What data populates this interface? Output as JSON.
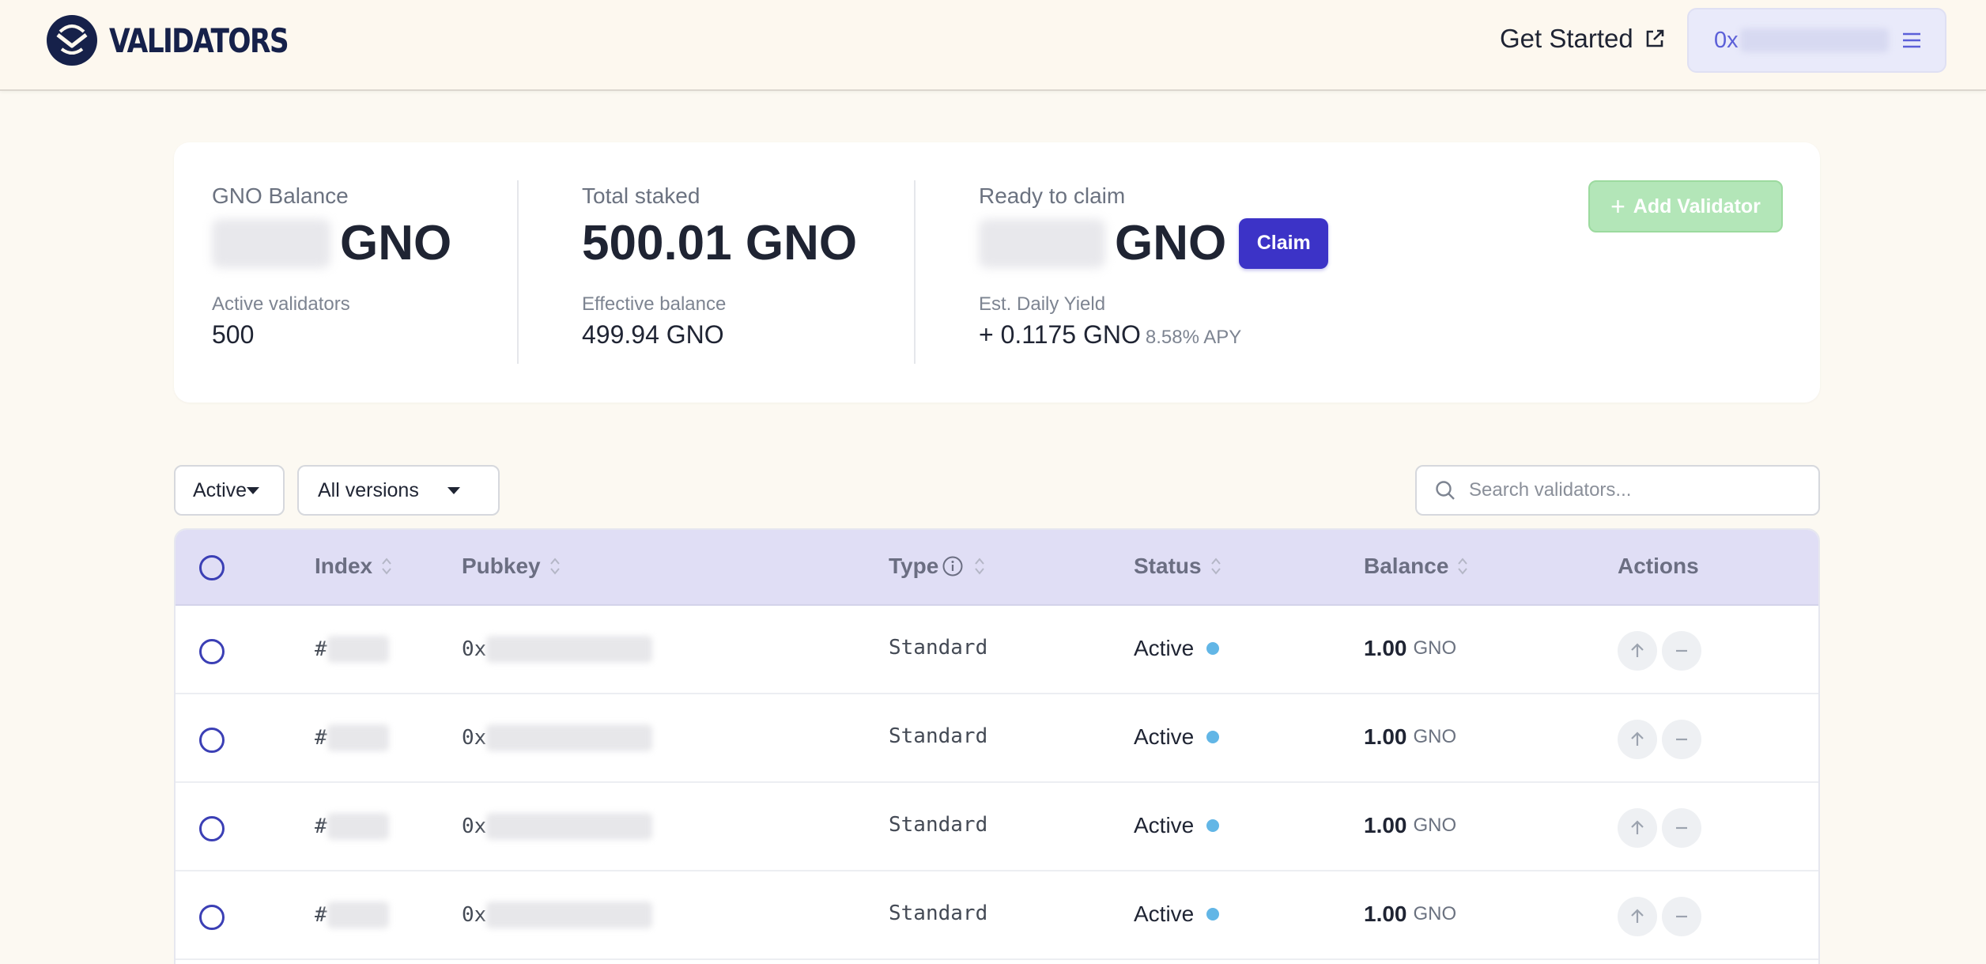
{
  "header": {
    "brand": "VALIDATORS",
    "get_started": "Get Started",
    "wallet_prefix": "0x"
  },
  "summary": {
    "gno_balance_label": "GNO Balance",
    "gno_balance_unit": "GNO",
    "active_validators_label": "Active validators",
    "active_validators_value": "500",
    "total_staked_label": "Total staked",
    "total_staked_value": "500.01 GNO",
    "effective_balance_label": "Effective balance",
    "effective_balance_value": "499.94 GNO",
    "ready_to_claim_label": "Ready to claim",
    "ready_to_claim_unit": "GNO",
    "claim_button": "Claim",
    "daily_yield_label": "Est. Daily Yield",
    "daily_yield_value": "+ 0.1175 GNO",
    "apy": "8.58% APY",
    "add_validator_button": "Add Validator"
  },
  "filters": {
    "status_selected": "Active",
    "version_selected": "All versions",
    "search_placeholder": "Search validators..."
  },
  "table": {
    "columns": {
      "index": "Index",
      "pubkey": "Pubkey",
      "type": "Type",
      "status": "Status",
      "balance": "Balance",
      "actions": "Actions"
    },
    "rows": [
      {
        "index_prefix": "#",
        "pubkey_prefix": "0x",
        "type": "Standard",
        "status": "Active",
        "balance": "1.00",
        "unit": "GNO"
      },
      {
        "index_prefix": "#",
        "pubkey_prefix": "0x",
        "type": "Standard",
        "status": "Active",
        "balance": "1.00",
        "unit": "GNO"
      },
      {
        "index_prefix": "#",
        "pubkey_prefix": "0x",
        "type": "Standard",
        "status": "Active",
        "balance": "1.00",
        "unit": "GNO"
      },
      {
        "index_prefix": "#",
        "pubkey_prefix": "0x",
        "type": "Standard",
        "status": "Active",
        "balance": "1.00",
        "unit": "GNO"
      }
    ]
  },
  "icons": {
    "logo": "validators-logo-icon",
    "external_link": "external-link-icon",
    "menu": "hamburger-menu-icon",
    "search": "search-icon",
    "sort": "sort-icon",
    "info": "info-icon",
    "up_arrow": "arrow-up-icon",
    "minus": "minus-icon"
  },
  "colors": {
    "accent": "#3c33c7",
    "header_bg": "#fdf8ef",
    "table_header_bg": "#e0def5",
    "add_validator_bg": "#b3e6b8",
    "status_active": "#62b6e6"
  }
}
